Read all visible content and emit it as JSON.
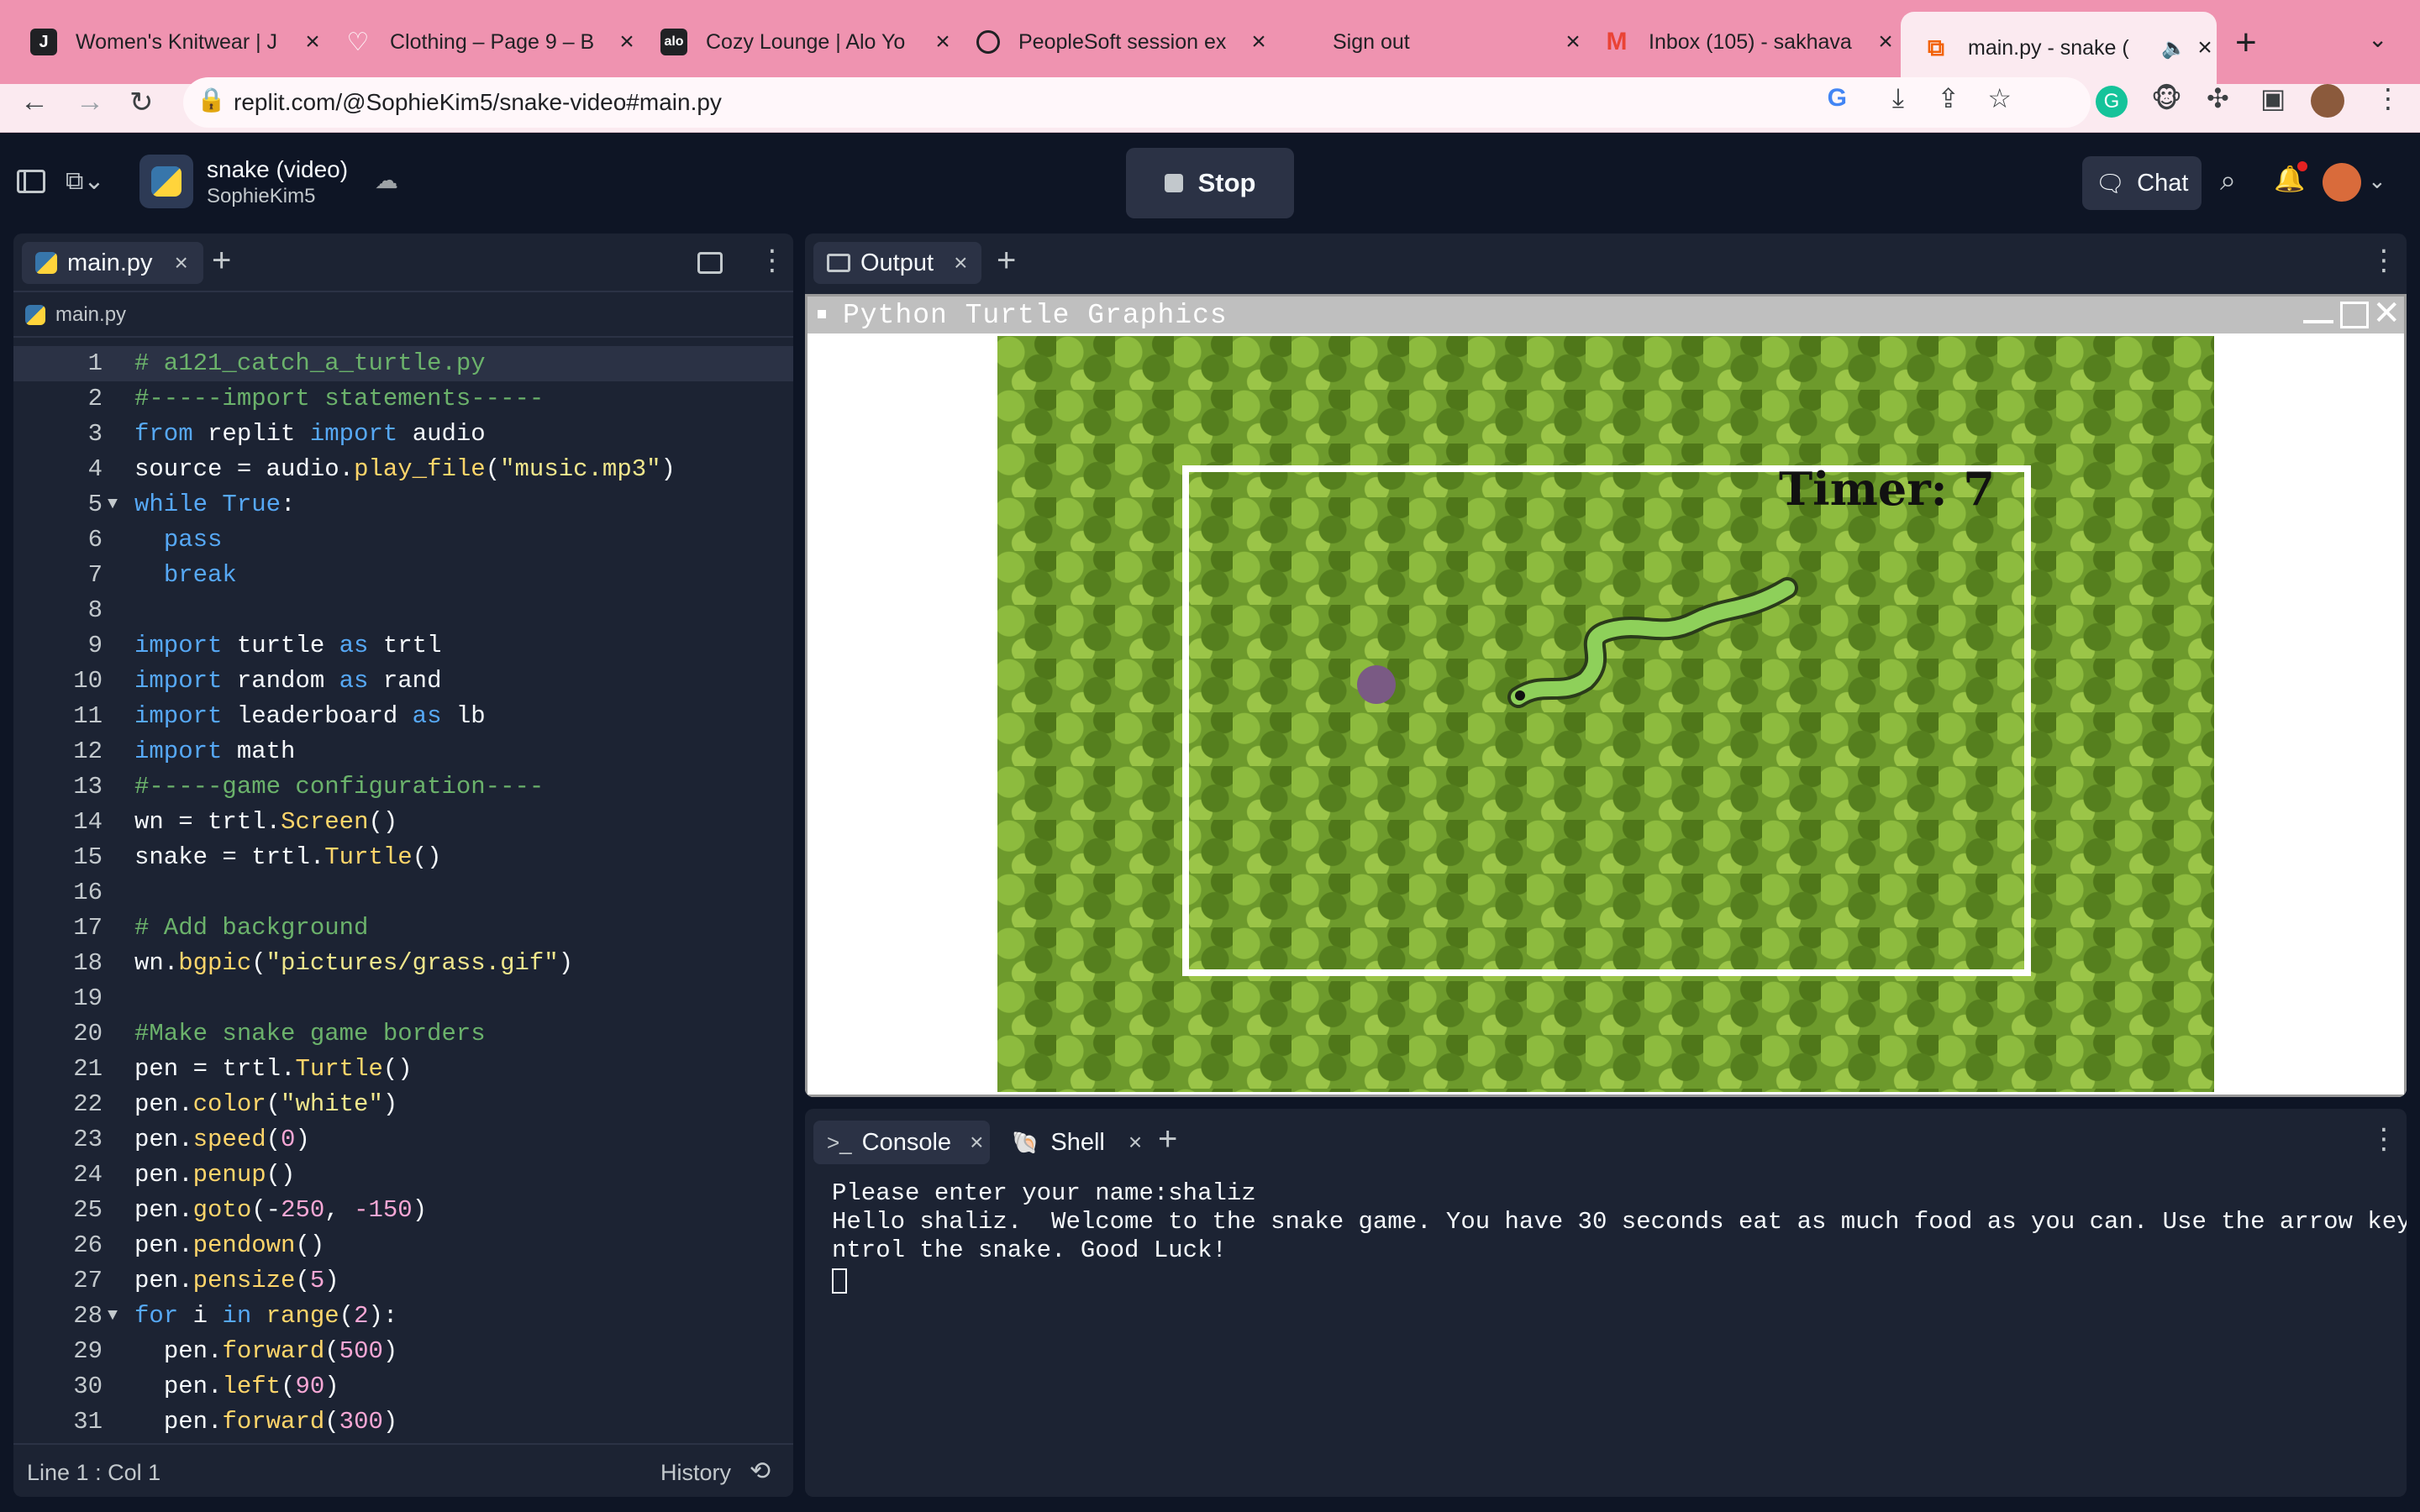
{
  "browser": {
    "tabs": [
      {
        "title": "Women's Knitwear | J",
        "favicon": "tab-favicon-j"
      },
      {
        "title": "Clothing – Page 9 – B",
        "favicon": "heart-icon"
      },
      {
        "title": "Cozy Lounge | Alo Yo",
        "favicon": "alo-icon"
      },
      {
        "title": "PeopleSoft session ex",
        "favicon": "globe-icon"
      },
      {
        "title": "Sign out",
        "favicon": "microsoft-icon"
      },
      {
        "title": "Inbox (105) - sakhava",
        "favicon": "gmail-icon"
      },
      {
        "title": "main.py - snake (",
        "favicon": "replit-icon"
      }
    ],
    "url": "replit.com/@SophieKim5/snake-video#main.py"
  },
  "replit": {
    "project_name": "snake (video)",
    "owner": "SophieKim5",
    "stop_label": "Stop",
    "chat_label": "Chat"
  },
  "editor": {
    "tab_label": "main.py",
    "breadcrumb": "main.py",
    "status": "Line 1 : Col 1",
    "history_label": "History",
    "lines": [
      "# a121_catch_a_turtle.py",
      "#-----import statements-----",
      "from replit import audio",
      "source = audio.play_file(\"music.mp3\")",
      "while True:",
      "  pass",
      "  break",
      "",
      "import turtle as trtl",
      "import random as rand",
      "import leaderboard as lb",
      "import math",
      "#-----game configuration----",
      "wn = trtl.Screen()",
      "snake = trtl.Turtle()",
      "",
      "# Add background",
      "wn.bgpic(\"pictures/grass.gif\")",
      "",
      "#Make snake game borders",
      "pen = trtl.Turtle()",
      "pen.color(\"white\")",
      "pen.speed(0)",
      "pen.penup()",
      "pen.goto(-250, -150)",
      "pen.pendown()",
      "pen.pensize(5)",
      "for i in range(2):",
      "  pen.forward(500)",
      "  pen.left(90)",
      "  pen.forward(300)"
    ]
  },
  "output": {
    "tab_label": "Output",
    "window_title": "Python Turtle Graphics",
    "timer_text": "Timer: 7"
  },
  "console": {
    "tab_console": "Console",
    "tab_shell": "Shell",
    "line1": "Please enter your name:shaliz",
    "line2": "Hello shaliz.  Welcome to the snake game. You have 30 seconds eat as much food as you can. Use the arrow keys to co",
    "line3": "ntrol the snake. Good Luck!"
  },
  "colors": {
    "tab_strip": "#ef93b0",
    "ide_bg": "#0e1525",
    "panel_bg": "#1c2333",
    "grass": "#6d9a2c"
  }
}
